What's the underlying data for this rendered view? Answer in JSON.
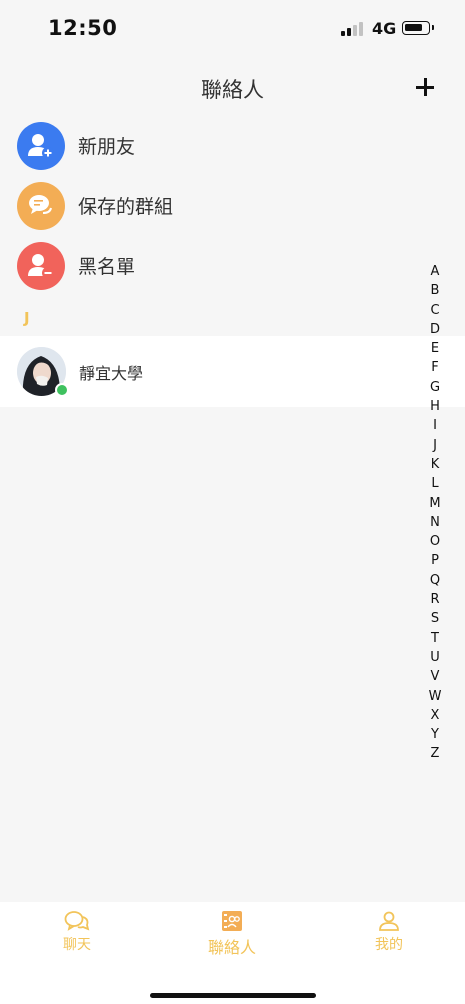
{
  "status_bar": {
    "time": "12:50",
    "network": "4G"
  },
  "nav": {
    "title": "聯絡人",
    "add_icon": "plus-icon"
  },
  "menu_items": [
    {
      "label": "新朋友",
      "icon": "add-user-icon",
      "color": "#3b7bf0"
    },
    {
      "label": "保存的群組",
      "icon": "group-chat-icon",
      "color": "#f3ad55"
    },
    {
      "label": "黑名單",
      "icon": "block-user-icon",
      "color": "#f1635b"
    }
  ],
  "section": {
    "letter": "J"
  },
  "contacts": [
    {
      "name": "靜宜大學",
      "online": true,
      "online_color": "#3ec15f"
    }
  ],
  "alpha_index": [
    "A",
    "B",
    "C",
    "D",
    "E",
    "F",
    "G",
    "H",
    "I",
    "J",
    "K",
    "L",
    "M",
    "N",
    "O",
    "P",
    "Q",
    "R",
    "S",
    "T",
    "U",
    "V",
    "W",
    "X",
    "Y",
    "Z"
  ],
  "tabs": [
    {
      "label": "聊天",
      "icon": "chat-icon"
    },
    {
      "label": "聯絡人",
      "icon": "contacts-icon",
      "active": true
    },
    {
      "label": "我的",
      "icon": "profile-icon"
    }
  ],
  "accent_color": "#f2c45a"
}
